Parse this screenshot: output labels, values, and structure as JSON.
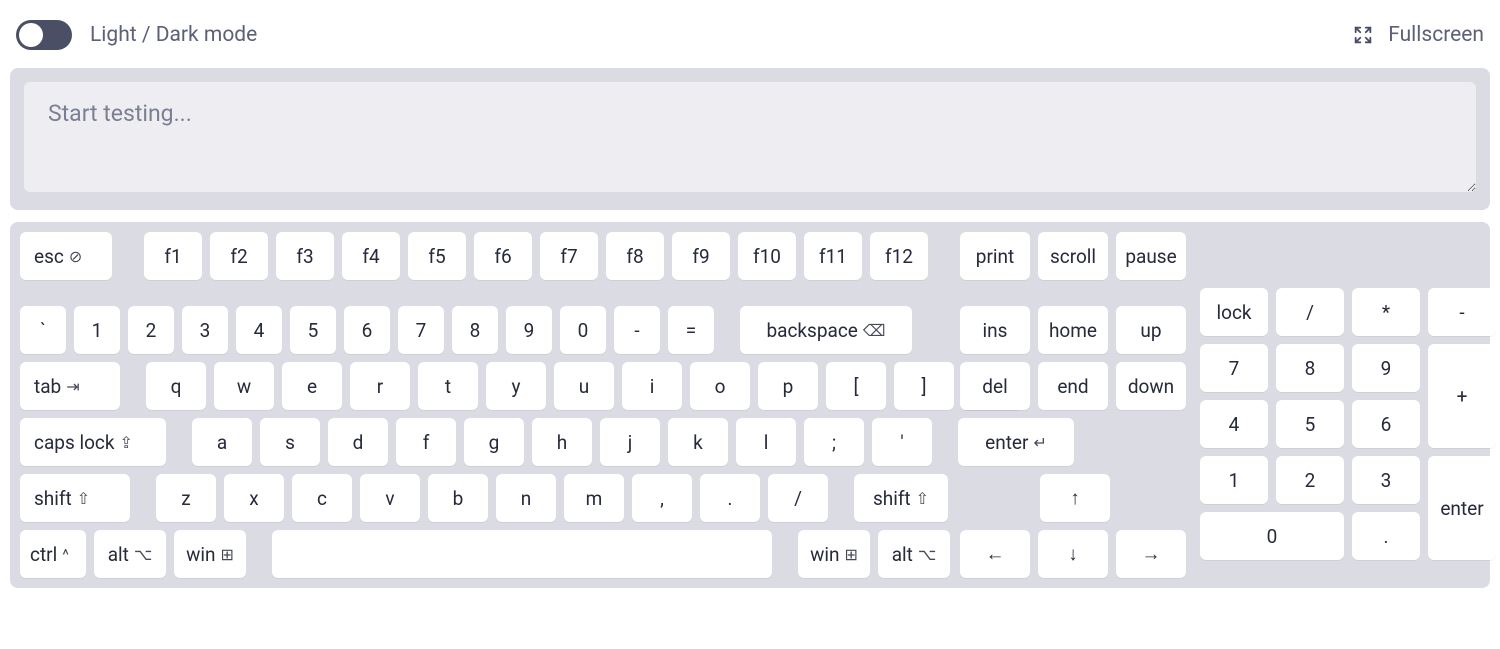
{
  "topbar": {
    "mode_label": "Light / Dark mode",
    "fullscreen_label": "Fullscreen"
  },
  "test_area": {
    "placeholder": "Start testing...",
    "value": ""
  },
  "icons": {
    "esc": "⊘",
    "backspace": "⌫",
    "tab": "⇥",
    "capslock": "⇪",
    "enter": "↵",
    "shift": "⇧",
    "ctrl": "^",
    "alt": "⌥",
    "win": "⊞"
  },
  "main": {
    "row0": [
      "esc",
      "f1",
      "f2",
      "f3",
      "f4",
      "f5",
      "f6",
      "f7",
      "f8",
      "f9",
      "f10",
      "f11",
      "f12"
    ],
    "row1": [
      "`",
      "1",
      "2",
      "3",
      "4",
      "5",
      "6",
      "7",
      "8",
      "9",
      "0",
      "-",
      "=",
      "backspace"
    ],
    "row2": [
      "tab",
      "q",
      "w",
      "e",
      "r",
      "t",
      "y",
      "u",
      "i",
      "o",
      "p",
      "[",
      "]",
      "\\"
    ],
    "row3": [
      "caps lock",
      "a",
      "s",
      "d",
      "f",
      "g",
      "h",
      "j",
      "k",
      "l",
      ";",
      "'",
      "enter"
    ],
    "row4": [
      "shift",
      "z",
      "x",
      "c",
      "v",
      "b",
      "n",
      "m",
      ",",
      ".",
      "/",
      "shift"
    ],
    "row5": [
      "ctrl",
      "alt",
      "win",
      "",
      "win",
      "alt"
    ]
  },
  "nav": {
    "row0": [
      "print",
      "scroll",
      "pause"
    ],
    "row1": [
      "ins",
      "home",
      "up"
    ],
    "row2": [
      "del",
      "end",
      "down"
    ],
    "row4": [
      "↑"
    ],
    "row5": [
      "←",
      "↓",
      "→"
    ]
  },
  "numpad": {
    "row1": [
      "lock",
      "/",
      "*",
      "-"
    ],
    "row2": [
      "7",
      "8",
      "9"
    ],
    "plus": "+",
    "row3": [
      "4",
      "5",
      "6"
    ],
    "row4": [
      "1",
      "2",
      "3"
    ],
    "enter": "enter",
    "row5": [
      "0",
      "."
    ]
  }
}
